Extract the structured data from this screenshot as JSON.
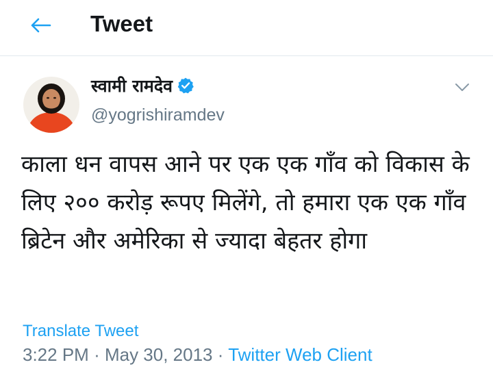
{
  "header": {
    "title": "Tweet",
    "back_icon": "arrow-left-icon"
  },
  "tweet": {
    "author_name": "स्वामी रामदेव",
    "verified_icon": "verified-badge-icon",
    "handle": "@yogrishiramdev",
    "menu_icon": "chevron-down-icon",
    "text": "काला धन वापस आने पर एक एक गाँव को विकास के लिए २०० करोड़ रूपए मिलेंगे, तो हमारा एक एक गाँव ब्रिटेन और अमेरिका से ज्यादा बेहतर होगा",
    "translate_label": "Translate Tweet",
    "time": "3:22 PM",
    "date": "May 30, 2013",
    "separator": "·",
    "client": "Twitter Web Client"
  },
  "colors": {
    "accent": "#1da1f2",
    "muted": "#657786",
    "text": "#14171a",
    "divider": "#e1e8ed"
  }
}
